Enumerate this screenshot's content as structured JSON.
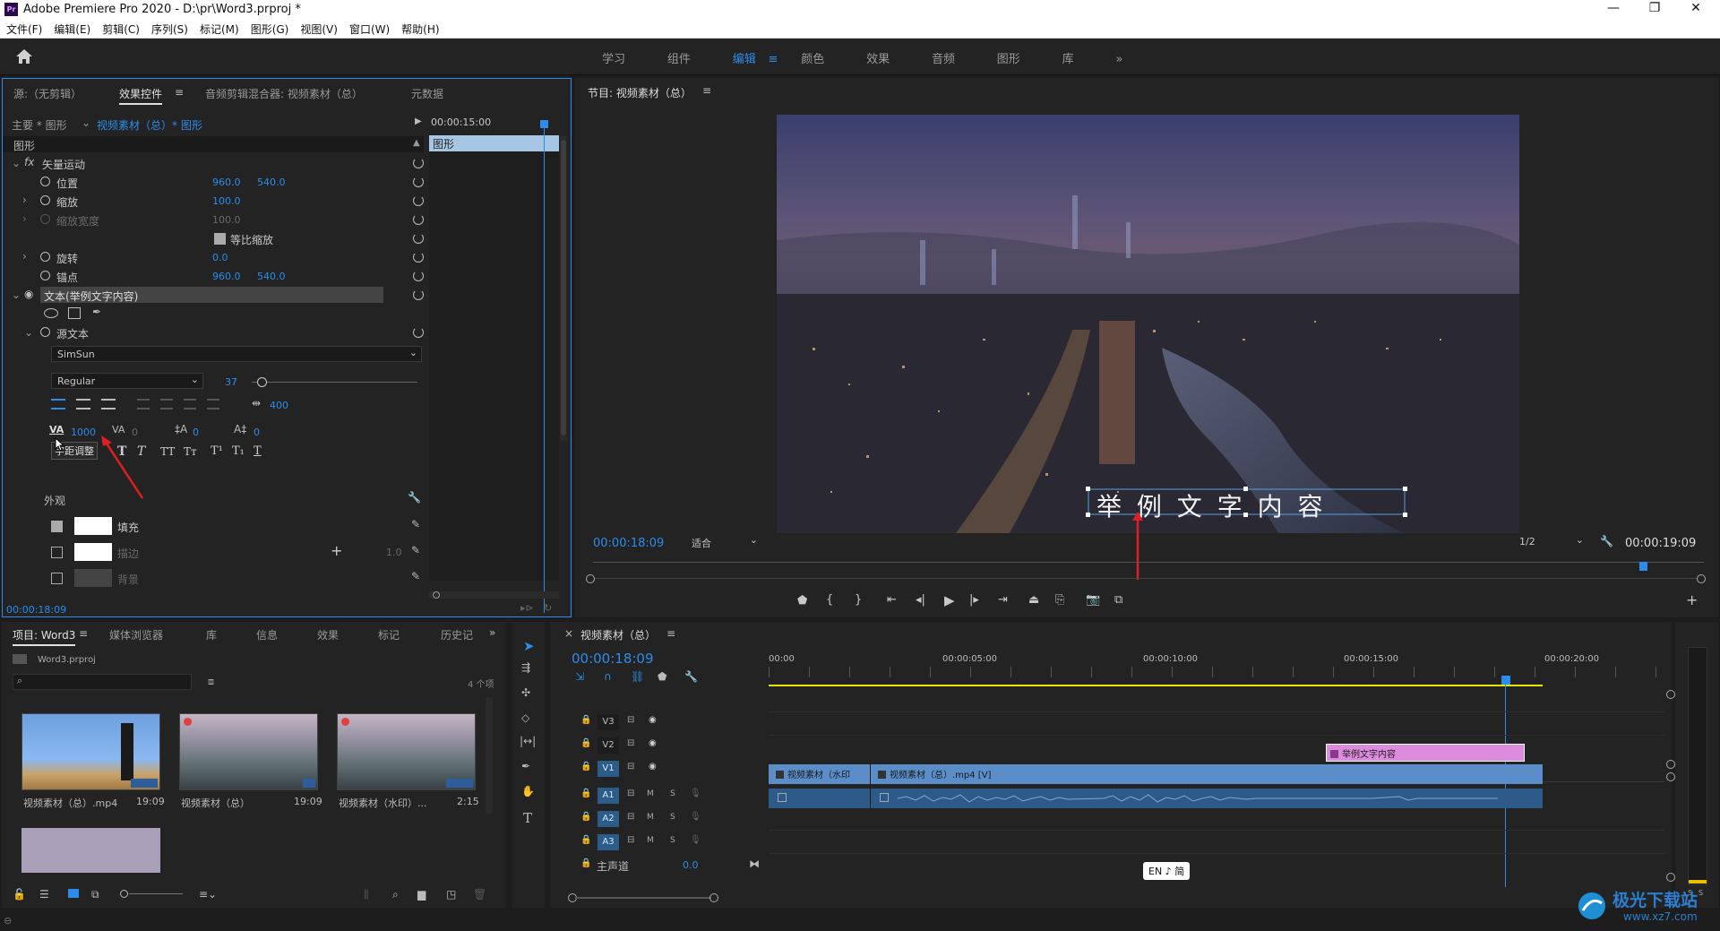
{
  "app": {
    "title": "Adobe Premiere Pro 2020 - D:\\pr\\Word3.prproj *",
    "logo_text": "Pr"
  },
  "menu": [
    "文件(F)",
    "编辑(E)",
    "剪辑(C)",
    "序列(S)",
    "标记(M)",
    "图形(G)",
    "视图(V)",
    "窗口(W)",
    "帮助(H)"
  ],
  "workspaces": [
    "学习",
    "组件",
    "编辑",
    "颜色",
    "效果",
    "音频",
    "图形",
    "库"
  ],
  "workspace_active": "编辑",
  "colors": {
    "accent": "#2d8ceb",
    "pink_clip": "#dd8bdd",
    "video_clip": "#5b8ec9",
    "audio_clip": "#2e5a89",
    "playhead": "#2d8ceb",
    "yellow_bar": "#e6e600"
  },
  "effects_panel": {
    "tabs": [
      "源:（无剪辑）",
      "效果控件",
      "音频剪辑混合器: 视频素材（总）",
      "元数据"
    ],
    "breadcrumb_master": "主要 * 图形",
    "breadcrumb_clip": "视频素材（总）* 图形",
    "timecode_start": "00:00:15:00",
    "graphic_label": "图形",
    "section_graphic": "图形",
    "vector_motion": "矢量运动",
    "position_label": "位置",
    "position_x": "960.0",
    "position_y": "540.0",
    "scale_label": "缩放",
    "scale_value": "100.0",
    "scale_width_label": "缩放宽度",
    "scale_width_value": "100.0",
    "uniform_scale": "等比缩放",
    "rotation_label": "旋转",
    "rotation_value": "0.0",
    "anchor_label": "锚点",
    "anchor_x": "960.0",
    "anchor_y": "540.0",
    "text_layer": "文本(举例文字内容)",
    "source_text": "源文本",
    "font": "SimSun",
    "font_style": "Regular",
    "font_size": "37",
    "tracking_box": "400",
    "kerning_value": "1000",
    "tracking_value": "0",
    "leading_value": "0",
    "baseline_value": "0",
    "tooltip": "字距调整",
    "appearance": "外观",
    "fill": "填充",
    "stroke": "描边",
    "stroke_width": "1.0",
    "background": "背景",
    "bottom_timecode": "00:00:18:09"
  },
  "program_monitor": {
    "title": "节目: 视频素材（总）",
    "overlay_text": "举 例 文 字 内 容",
    "timecode_current": "00:00:18:09",
    "fit": "适合",
    "resolution": "1/2",
    "timecode_duration": "00:00:19:09"
  },
  "project_panel": {
    "tabs": [
      "项目: Word3",
      "媒体浏览器",
      "库",
      "信息",
      "效果",
      "标记",
      "历史记"
    ],
    "file_name": "Word3.prproj",
    "item_count": "4 个项",
    "items": [
      {
        "name": "视频素材（总）.mp4",
        "duration": "19:09"
      },
      {
        "name": "视频素材（总）",
        "duration": "19:09"
      },
      {
        "name": "视频素材（水印）...",
        "duration": "2:15"
      }
    ]
  },
  "timeline": {
    "sequence_name": "视频素材（总）",
    "timecode": "00:00:18:09",
    "ruler": [
      "00:00",
      "00:00:05:00",
      "00:00:10:00",
      "00:00:15:00",
      "00:00:20:00"
    ],
    "tracks": [
      "V3",
      "V2",
      "V1",
      "A1",
      "A2",
      "A3"
    ],
    "master_label": "主声道",
    "master_value": "0.0",
    "clip_title": "举例文字内容",
    "clip_v1_a": "视频素材（水印",
    "clip_v1_b": "视频素材（总）.mp4 [V]",
    "ime": "EN ♪ 简",
    "m_label": "M",
    "s_label": "S"
  },
  "watermark": {
    "text": "极光下载站",
    "url": "www.xz7.com"
  }
}
